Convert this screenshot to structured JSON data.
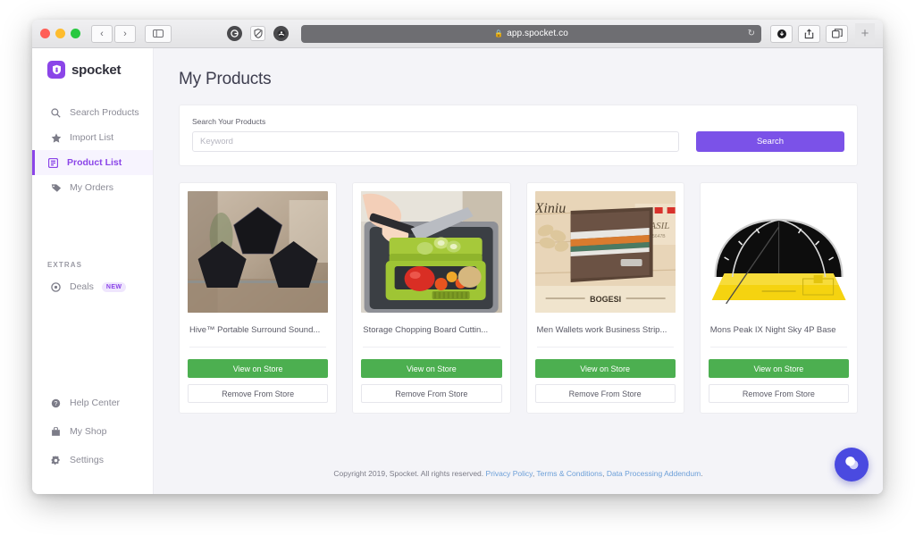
{
  "browser": {
    "url": "app.spocket.co",
    "lock_icon": "lock-icon",
    "back_icon": "‹",
    "forward_icon": "›",
    "sidebar_toggle_icon": "▤",
    "reload_icon": "↻",
    "extension_icons": [
      "grammarly-icon",
      "shield-privacy-icon",
      "extension-dark-icon"
    ],
    "downloads_icon": "⬇",
    "share_icon": "⤴",
    "tabs_icon": "⧉",
    "new_tab_icon": "+"
  },
  "sidebar": {
    "brand": "spocket",
    "items": [
      {
        "label": "Search Products",
        "icon": "search-icon",
        "active": false
      },
      {
        "label": "Import List",
        "icon": "star-icon",
        "active": false
      },
      {
        "label": "Product List",
        "icon": "list-icon",
        "active": true
      },
      {
        "label": "My Orders",
        "icon": "tag-icon",
        "active": false
      }
    ],
    "section_label": "EXTRAS",
    "extras": [
      {
        "label": "Deals",
        "icon": "deals-icon",
        "badge": "NEW"
      }
    ],
    "bottom_items": [
      {
        "label": "Help Center",
        "icon": "help-circle-icon"
      },
      {
        "label": "My Shop",
        "icon": "shop-icon"
      },
      {
        "label": "Settings",
        "icon": "gear-icon"
      }
    ]
  },
  "main": {
    "page_title": "My Products",
    "search": {
      "label": "Search Your Products",
      "placeholder": "Keyword",
      "value": "",
      "button_label": "Search"
    },
    "products": [
      {
        "title": "Hive™ Portable Surround Sound...",
        "view_label": "View on Store",
        "remove_label": "Remove From Store",
        "image": "black-pentagon-speakers"
      },
      {
        "title": "Storage Chopping Board Cuttin...",
        "view_label": "View on Store",
        "remove_label": "Remove From Store",
        "image": "green-chopping-board-sink"
      },
      {
        "title": "Men Wallets work Business Strip...",
        "view_label": "View on Store",
        "remove_label": "Remove From Store",
        "image": "brown-striped-wallet"
      },
      {
        "title": "Mons Peak IX Night Sky 4P Base",
        "view_label": "View on Store",
        "remove_label": "Remove From Store",
        "image": "yellow-black-dome-tent"
      }
    ]
  },
  "footer": {
    "copyright": "Copyright 2019, Spocket. All rights reserved.",
    "links": [
      "Privacy Policy",
      "Terms & Conditions",
      "Data Processing Addendum"
    ],
    "separator": ", ",
    "period": "."
  },
  "chat": {
    "icon": "chat-bubbles-icon"
  },
  "colors": {
    "brand_purple": "#8b45e8",
    "search_button": "#7b52e8",
    "view_button_green": "#4caf50",
    "link_blue": "#6c9fd8",
    "chat_blue": "#4a4ae0"
  }
}
